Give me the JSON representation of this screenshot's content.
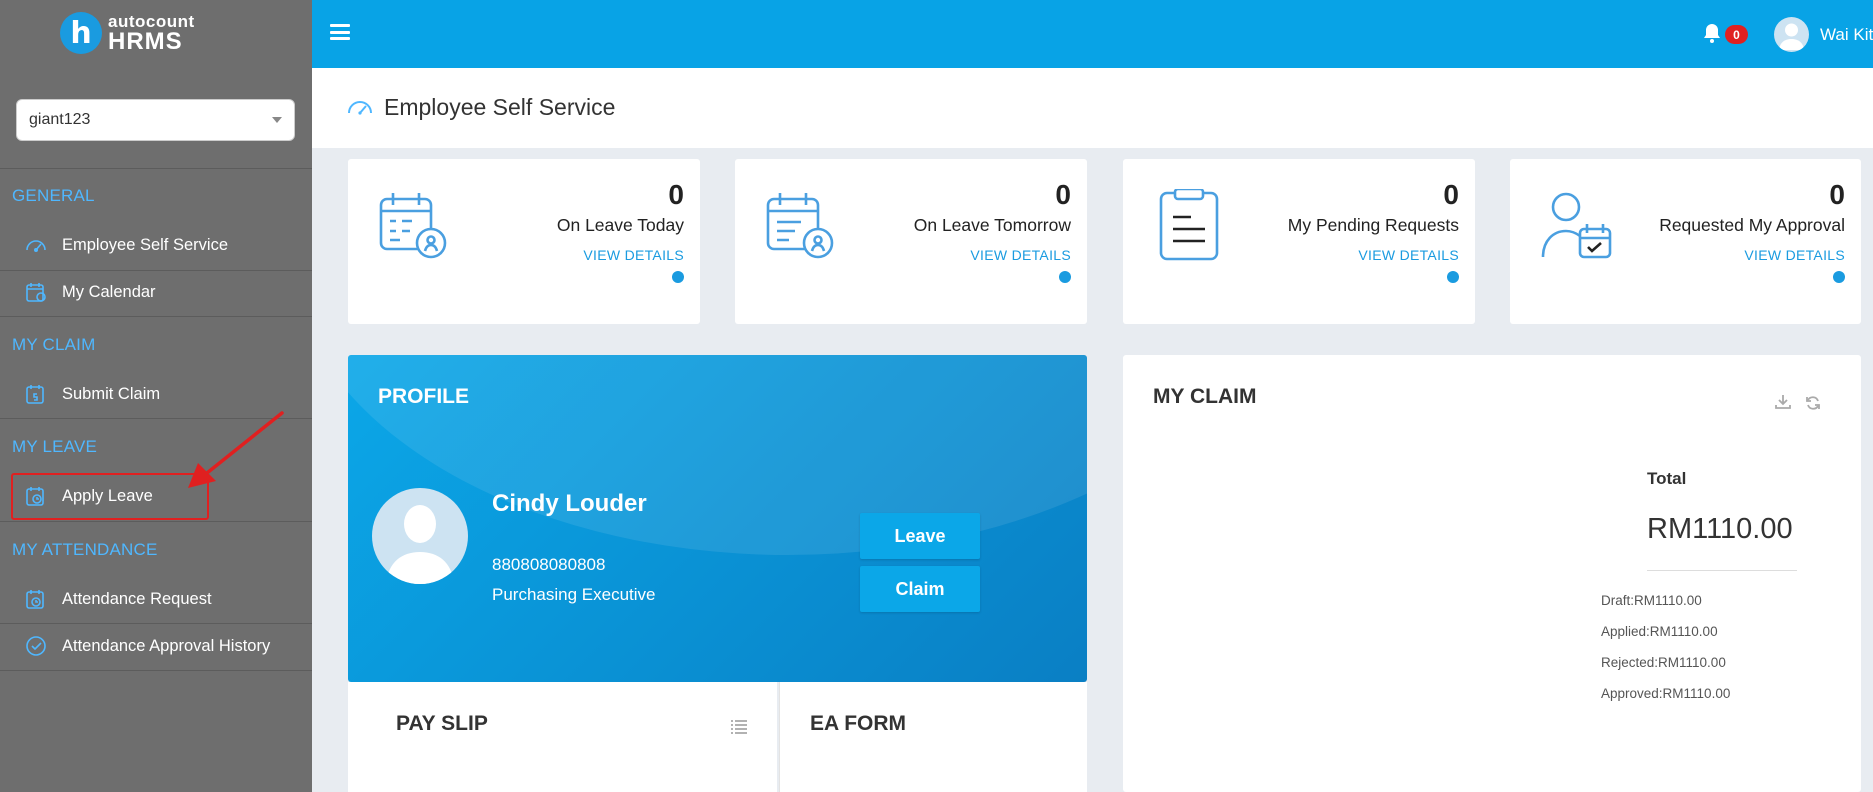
{
  "logo": {
    "badge": "h",
    "top": "autocount",
    "bottom": "HRMS"
  },
  "company_select": {
    "value": "giant123"
  },
  "nav": {
    "sections": [
      {
        "label": "GENERAL",
        "items": [
          "Employee Self Service",
          "My Calendar"
        ]
      },
      {
        "label": "MY CLAIM",
        "items": [
          "Submit Claim"
        ]
      },
      {
        "label": "MY LEAVE",
        "items": [
          "Apply Leave"
        ]
      },
      {
        "label": "MY ATTENDANCE",
        "items": [
          "Attendance Request",
          "Attendance Approval History"
        ]
      }
    ]
  },
  "topbar": {
    "notification_count": "0",
    "user_name": "Wai Kit"
  },
  "page": {
    "title": "Employee Self Service"
  },
  "stats": [
    {
      "value": "0",
      "label": "On Leave Today",
      "link": "VIEW DETAILS",
      "icon": "calendar-person-icon"
    },
    {
      "value": "0",
      "label": "On Leave Tomorrow",
      "link": "VIEW DETAILS",
      "icon": "calendar-list-icon"
    },
    {
      "value": "0",
      "label": "My Pending Requests",
      "link": "VIEW DETAILS",
      "icon": "clipboard-icon"
    },
    {
      "value": "0",
      "label": "Requested My Approval",
      "link": "VIEW DETAILS",
      "icon": "user-calendar-check-icon"
    }
  ],
  "profile": {
    "title": "PROFILE",
    "name": "Cindy Louder",
    "id": "880808080808",
    "position": "Purchasing Executive",
    "leave_button": "Leave",
    "claim_button": "Claim"
  },
  "payslip": {
    "title": "PAY SLIP"
  },
  "ea_form": {
    "title": "EA FORM"
  },
  "my_claim": {
    "title": "MY CLAIM",
    "total_label": "Total",
    "total": "RM1110.00",
    "draft": "Draft:RM1110.00",
    "applied": "Applied:RM1110.00",
    "rejected": "Rejected:RM1110.00",
    "approved": "Approved:RM1110.00"
  },
  "colors": {
    "accent": "#08a3e6",
    "sidebar": "#6e6e6e",
    "section": "#4fb7ff",
    "highlight": "#e02020"
  }
}
